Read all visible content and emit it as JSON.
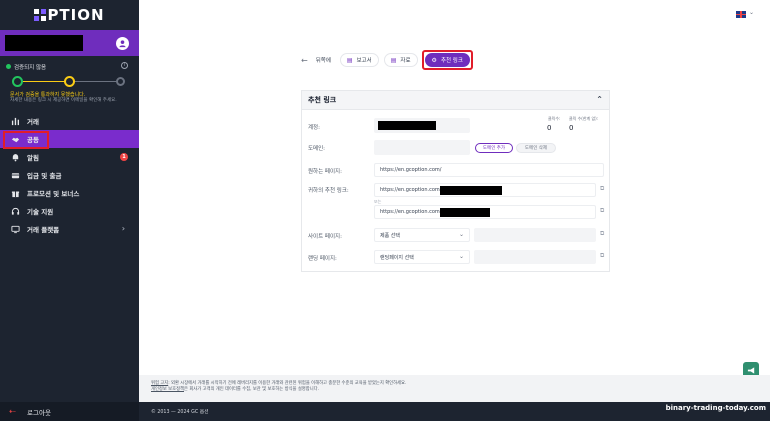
{
  "sidebar": {
    "logo_text": "PTION",
    "verification": {
      "title": "검증되지 않음",
      "warning": "문서가 검증을 통과하지 못했습니다.",
      "sub": "자세한 내용은 링크 시 제공하면 이메일을 확인해 주세요."
    },
    "items": [
      {
        "label": "거래",
        "icon": "chart-icon"
      },
      {
        "label": "공동",
        "icon": "handshake-icon"
      },
      {
        "label": "알림",
        "icon": "bell-icon",
        "badge": "1"
      },
      {
        "label": "입금 및 출금",
        "icon": "card-icon"
      },
      {
        "label": "프로모션 및 보너스",
        "icon": "gift-icon"
      },
      {
        "label": "기술 지원",
        "icon": "headset-icon"
      },
      {
        "label": "거래 플랫폼",
        "icon": "monitor-icon"
      }
    ],
    "logout": "로그아웃"
  },
  "breadcrumb": {
    "back": "뒤쪽에",
    "tabs": [
      "보고서",
      "자료",
      "추천 링크"
    ]
  },
  "panel": {
    "title": "추천 링크",
    "account_label": "계정:",
    "stat1_label": "클릭수:",
    "stat1_value": "0",
    "stat2_label": "클릭 수(한계 없):",
    "stat2_value": "0",
    "domain_label": "도메인:",
    "btn_add_domain": "도메인 추가",
    "btn_del_domain": "도메인 삭제",
    "desired_page_label": "원하는 페이지:",
    "desired_page_value": "https://en.gcoption.com/",
    "your_link_label": "귀하의 추천 링크:",
    "link1_prefix": "https://en.gcoption.com",
    "or": "또는",
    "link2_prefix": "https://en.gcoption.com",
    "site_page_label": "사이트 페이지:",
    "site_page_select": "제품 선택",
    "landing_page_label": "랜딩 페이지:",
    "landing_page_select": "랜딩페이지 선택"
  },
  "footer": {
    "disclaimer_link1": "위험 고지",
    "disclaimer1": ": 외환 시장에서 거래를 시작하기 전에 레버리지를 이용한 거래와 관련된 위험을 이해하고 충분한 수준의 교육을 받았는지 확인하세요.",
    "disclaimer_link2": "개인정보 보호정책",
    "disclaimer2": "은 회사가 고객의 개인 데이터를 수집, 보관 및 보호하는 방식을 설명합니다.",
    "copyright": "© 2013 — 2024 GC 옵션",
    "watermark": "binary-trading-today.com"
  }
}
